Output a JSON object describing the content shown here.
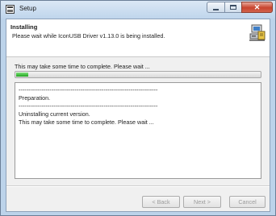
{
  "window": {
    "title": "Setup"
  },
  "header": {
    "title": "Installing",
    "subtitle": "Please wait while IconUSB Driver v1.13.0 is being installed.",
    "icon": "installer-computer-icon"
  },
  "status": {
    "text": "This may take some time to complete. Please wait ...",
    "progress_fraction": 0.02
  },
  "log": {
    "lines": [
      "------------------------------------------------------------------------",
      "Preparation.",
      "------------------------------------------------------------------------",
      "Uninstalling current version.",
      "This may take some time to complete. Please wait ..."
    ]
  },
  "buttons": {
    "back": "< Back",
    "next": "Next >",
    "cancel": "Cancel"
  },
  "colors": {
    "progress": "#2db82d",
    "close_button": "#c8442e"
  }
}
